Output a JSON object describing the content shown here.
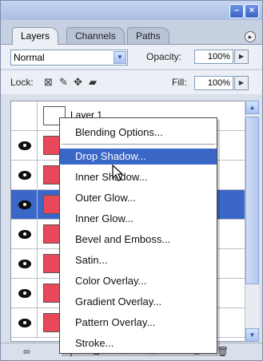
{
  "titlebar": {
    "buttons": [
      {
        "name": "minimize-icon",
        "glyph": "–"
      },
      {
        "name": "close-icon",
        "glyph": "×"
      }
    ]
  },
  "tabs": [
    {
      "label": "Layers",
      "active": true
    },
    {
      "label": "Channels",
      "active": false
    },
    {
      "label": "Paths",
      "active": false
    }
  ],
  "controls": {
    "blend_mode": "Normal",
    "opacity_label": "Opacity:",
    "opacity_value": "100%",
    "lock_label": "Lock:",
    "fill_label": "Fill:",
    "fill_value": "100%"
  },
  "layers": [
    {
      "name": "Layer 1",
      "visible": false,
      "selected": false,
      "thumb_color": "#ffffff"
    },
    {
      "name": "",
      "visible": true,
      "selected": false,
      "thumb_color": "#e9475a"
    },
    {
      "name": "",
      "visible": true,
      "selected": false,
      "thumb_color": "#e9475a"
    },
    {
      "name": "",
      "visible": true,
      "selected": true,
      "thumb_color": "#e9475a"
    },
    {
      "name": "",
      "visible": true,
      "selected": false,
      "thumb_color": "#e9475a"
    },
    {
      "name": "",
      "visible": true,
      "selected": false,
      "thumb_color": "#e9475a"
    },
    {
      "name": "",
      "visible": true,
      "selected": false,
      "thumb_color": "#e9475a"
    },
    {
      "name": "",
      "visible": true,
      "selected": false,
      "thumb_color": "#e9475a"
    }
  ],
  "context_menu": {
    "items": [
      {
        "label": "Blending Options..."
      },
      {
        "label": "Drop Shadow...",
        "highlighted": true
      },
      {
        "label": "Inner Shadow..."
      },
      {
        "label": "Outer Glow..."
      },
      {
        "label": "Inner Glow..."
      },
      {
        "label": "Bevel and Emboss..."
      },
      {
        "label": "Satin..."
      },
      {
        "label": "Color Overlay..."
      },
      {
        "label": "Gradient Overlay..."
      },
      {
        "label": "Pattern Overlay..."
      },
      {
        "label": "Stroke..."
      }
    ]
  },
  "colors": {
    "selection": "#3b67c8",
    "menu_highlight": "#3a66c6",
    "layer_thumb": "#e9475a"
  }
}
